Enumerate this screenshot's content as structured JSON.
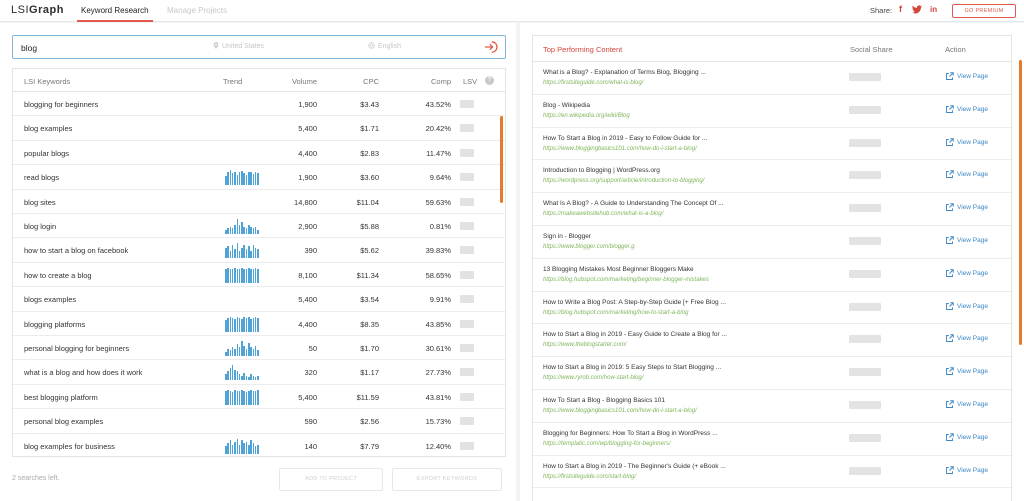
{
  "header": {
    "logo_light": "LSI",
    "logo_bold": "Graph",
    "tabs": [
      {
        "label": "Keyword Research",
        "active": true
      },
      {
        "label": "Manage Projects",
        "active": false
      }
    ],
    "share_label": "Share:",
    "social_icons": [
      "facebook-icon",
      "twitter-icon",
      "linkedin-icon"
    ],
    "premium_label": "GO PREMIUM",
    "accent_color": "#e25a4b"
  },
  "search": {
    "query": "blog",
    "location_placeholder": "United States",
    "language_placeholder": "English"
  },
  "keyword_table": {
    "columns": [
      "LSI Keywords",
      "Trend",
      "Volume",
      "CPC",
      "Comp",
      "LSV"
    ],
    "rows": [
      {
        "keyword": "blogging for beginners",
        "volume": "1,900",
        "cpc": "$3.43",
        "comp": "43.52%",
        "trend": []
      },
      {
        "keyword": "blog examples",
        "volume": "5,400",
        "cpc": "$1.71",
        "comp": "20.42%",
        "trend": []
      },
      {
        "keyword": "popular blogs",
        "volume": "4,400",
        "cpc": "$2.83",
        "comp": "11.47%",
        "trend": []
      },
      {
        "keyword": "read blogs",
        "volume": "1,900",
        "cpc": "$3.60",
        "comp": "9.64%",
        "trend": [
          0.6,
          0.9,
          1,
          0.8,
          0.9,
          0.7,
          0.85,
          0.95,
          0.8,
          0.7,
          0.9,
          0.85,
          0.75,
          0.9,
          0.8
        ]
      },
      {
        "keyword": "blog sites",
        "volume": "14,800",
        "cpc": "$11.04",
        "comp": "59.63%",
        "trend": []
      },
      {
        "keyword": "blog login",
        "volume": "2,900",
        "cpc": "$5.88",
        "comp": "0.81%",
        "trend": [
          0.3,
          0.4,
          0.5,
          0.4,
          0.6,
          1,
          0.6,
          0.8,
          0.5,
          0.4,
          0.6,
          0.5,
          0.4,
          0.5,
          0.3
        ]
      },
      {
        "keyword": "how to start a blog on facebook",
        "volume": "390",
        "cpc": "$5.62",
        "comp": "39.83%",
        "trend": [
          0.7,
          0.8,
          0.5,
          0.9,
          0.6,
          1,
          0.5,
          0.7,
          0.9,
          0.6,
          0.8,
          0.5,
          0.9,
          0.7,
          0.6
        ]
      },
      {
        "keyword": "how to create a blog",
        "volume": "8,100",
        "cpc": "$11.34",
        "comp": "58.65%",
        "trend": [
          0.9,
          1,
          0.95,
          0.9,
          1,
          0.95,
          0.9,
          1,
          0.95,
          0.9,
          1,
          0.95,
          0.9,
          1,
          0.95
        ]
      },
      {
        "keyword": "blogs examples",
        "volume": "5,400",
        "cpc": "$3.54",
        "comp": "9.91%",
        "trend": []
      },
      {
        "keyword": "blogging platforms",
        "volume": "4,400",
        "cpc": "$8.35",
        "comp": "43.85%",
        "trend": [
          0.8,
          0.9,
          1,
          0.9,
          0.85,
          0.95,
          0.9,
          0.85,
          1,
          0.9,
          0.95,
          0.85,
          0.9,
          1,
          0.9
        ]
      },
      {
        "keyword": "personal blogging for beginners",
        "volume": "50",
        "cpc": "$1.70",
        "comp": "30.61%",
        "trend": [
          0.3,
          0.5,
          0.4,
          0.6,
          0.5,
          0.8,
          0.6,
          1,
          0.7,
          0.5,
          0.9,
          0.6,
          0.5,
          0.7,
          0.4
        ]
      },
      {
        "keyword": "what is a blog and how does it work",
        "volume": "320",
        "cpc": "$1.17",
        "comp": "27.73%",
        "trend": [
          0.4,
          0.6,
          0.8,
          1,
          0.7,
          0.6,
          0.4,
          0.3,
          0.5,
          0.3,
          0.2,
          0.4,
          0.3,
          0.2,
          0.3
        ]
      },
      {
        "keyword": "best blogging platform",
        "volume": "5,400",
        "cpc": "$11.59",
        "comp": "43.81%",
        "trend": [
          0.9,
          1,
          0.95,
          0.85,
          1,
          0.9,
          0.95,
          1,
          0.9,
          0.85,
          0.95,
          1,
          0.9,
          0.95,
          1
        ]
      },
      {
        "keyword": "personal blog examples",
        "volume": "590",
        "cpc": "$2.56",
        "comp": "15.73%",
        "trend": []
      },
      {
        "keyword": "blog examples for business",
        "volume": "140",
        "cpc": "$7.79",
        "comp": "12.40%",
        "trend": [
          0.5,
          0.7,
          0.9,
          0.6,
          0.8,
          1,
          0.6,
          0.9,
          0.7,
          0.8,
          0.6,
          0.9,
          0.7,
          0.5,
          0.6
        ]
      }
    ],
    "trend_color": "#4fa3d6"
  },
  "footer": {
    "searches_left": "2 searches left.",
    "add_to_projects": "ADD TO PROJECT",
    "export": "EXPORT KEYWORDS"
  },
  "top_content": {
    "columns": [
      "Top Performing Content",
      "Social Share",
      "Action"
    ],
    "action_label": "View Page",
    "items": [
      {
        "title": "What is a Blog? - Explanation of Terms Blog, Blogging ...",
        "url": "https://firstsiteguide.com/what-is-blog/"
      },
      {
        "title": "Blog - Wikipedia",
        "url": "https://en.wikipedia.org/wiki/Blog"
      },
      {
        "title": "How To Start a Blog in 2019 - Easy to Follow Guide for ...",
        "url": "https://www.bloggingbasics101.com/how-do-i-start-a-blog/"
      },
      {
        "title": "Introduction to Blogging | WordPress.org",
        "url": "https://wordpress.org/support/article/introduction-to-blogging/"
      },
      {
        "title": "What Is A Blog? - A Guide to Understanding The Concept Of ...",
        "url": "https://makeawebsitehub.com/what-is-a-blog/"
      },
      {
        "title": "Sign in - Blogger",
        "url": "https://www.blogger.com/blogger.g"
      },
      {
        "title": "13 Blogging Mistakes Most Beginner Bloggers Make",
        "url": "https://blog.hubspot.com/marketing/beginner-blogger-mistakes"
      },
      {
        "title": "How to Write a Blog Post: A Step-by-Step Guide [+ Free Blog ...",
        "url": "https://blog.hubspot.com/marketing/how-to-start-a-blog"
      },
      {
        "title": "How to Start a Blog in 2019 - Easy Guide to Create a Blog for ...",
        "url": "https://www.theblogstarter.com/"
      },
      {
        "title": "How to Start a Blog in 2019: 5 Easy Steps to Start Blogging ...",
        "url": "https://www.ryrob.com/how-start-blog/"
      },
      {
        "title": "How To Start a Blog - Blogging Basics 101",
        "url": "https://www.bloggingbasics101.com/how-do-i-start-a-blog/"
      },
      {
        "title": "Blogging for Beginners: How To Start a Blog in WordPress ...",
        "url": "https://templatic.com/wp/blogging-for-beginners/"
      },
      {
        "title": "How to Start a Blog in 2019 - The Beginner's Guide (+ eBook ...",
        "url": "https://firstsiteguide.com/start-blog/"
      }
    ]
  }
}
